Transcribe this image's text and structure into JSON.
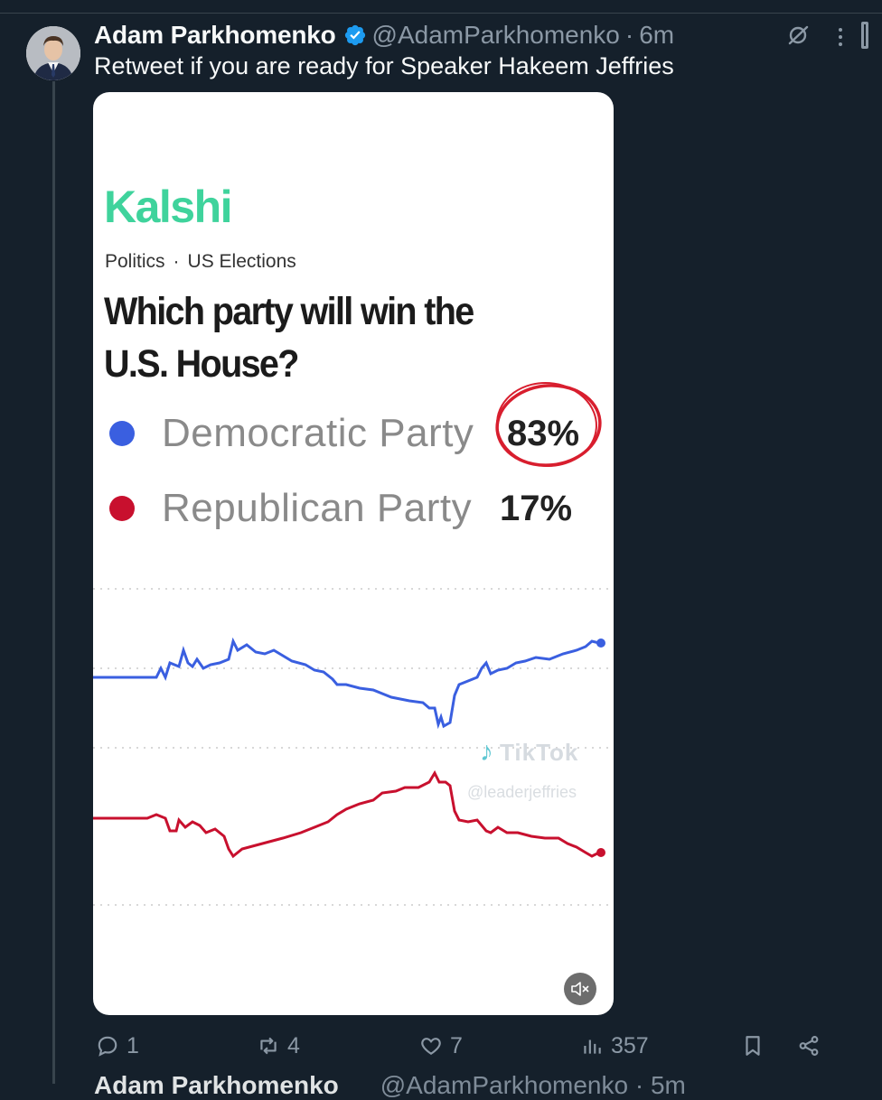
{
  "tweet": {
    "author_name": "Adam Parkhomenko",
    "handle": "@AdamParkhomenko",
    "separator": "·",
    "time": "6m",
    "text": "Retweet if you are ready for Speaker Hakeem Jeffries"
  },
  "media": {
    "brand": "Kalshi",
    "breadcrumb": {
      "category": "Politics",
      "separator": "·",
      "subcategory": "US Elections"
    },
    "question": "Which party will win the U.S. House?",
    "outcomes": [
      {
        "label": "Democratic Party",
        "percent": "83%",
        "color": "#3a5fe0"
      },
      {
        "label": "Republican Party",
        "percent": "17%",
        "color": "#c8102e"
      }
    ],
    "watermark": {
      "brand": "TikTok",
      "handle": "@leaderjeffries"
    },
    "colors": {
      "brand": "#3fd39c",
      "highlight_circle": "#d81e2e"
    }
  },
  "actions": {
    "replies": "1",
    "retweets": "4",
    "likes": "7",
    "views": "357"
  },
  "next_tweet": {
    "author_name": "Adam Parkhomenko",
    "handle": "@AdamParkhomenko · 5m"
  },
  "theme": {
    "background": "#15202b",
    "divider": "#38444d",
    "secondary_text": "#8b98a5",
    "verified": "#1d9bf0"
  }
}
